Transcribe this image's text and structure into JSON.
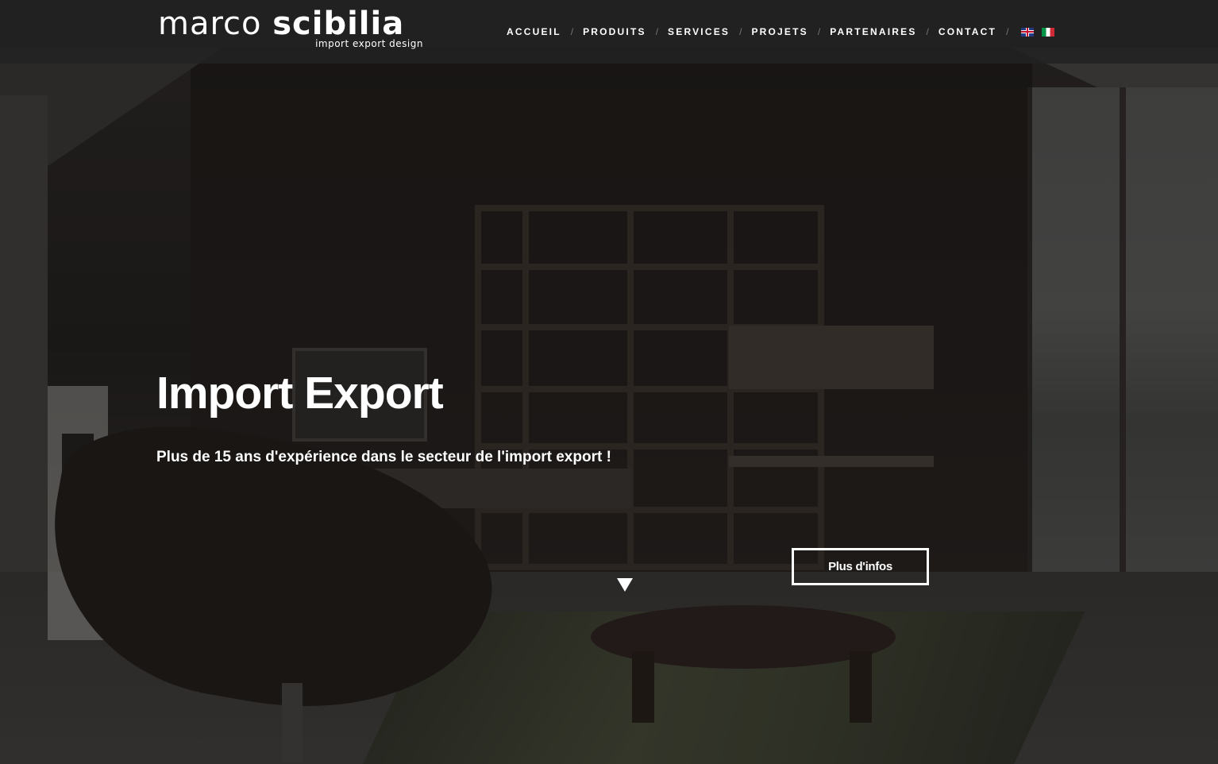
{
  "brand": {
    "name_light": "marco",
    "name_bold": "scibilia",
    "tagline": "import export design"
  },
  "nav": {
    "items": [
      "ACCUEIL",
      "PRODUITS",
      "SERVICES",
      "PROJETS",
      "PARTENAIRES",
      "CONTACT"
    ],
    "separator": "/",
    "languages": [
      {
        "code": "en",
        "icon": "uk-flag-icon"
      },
      {
        "code": "it",
        "icon": "italy-flag-icon"
      }
    ]
  },
  "hero": {
    "title": "Import Export",
    "subtitle": "Plus de 15 ans d'expérience dans le secteur de l'import export !",
    "cta_label": "Plus d'infos",
    "scroll_icon": "triangle-down-icon"
  },
  "colors": {
    "header_bg": "#222222",
    "text": "#ffffff",
    "separator": "#777777"
  }
}
